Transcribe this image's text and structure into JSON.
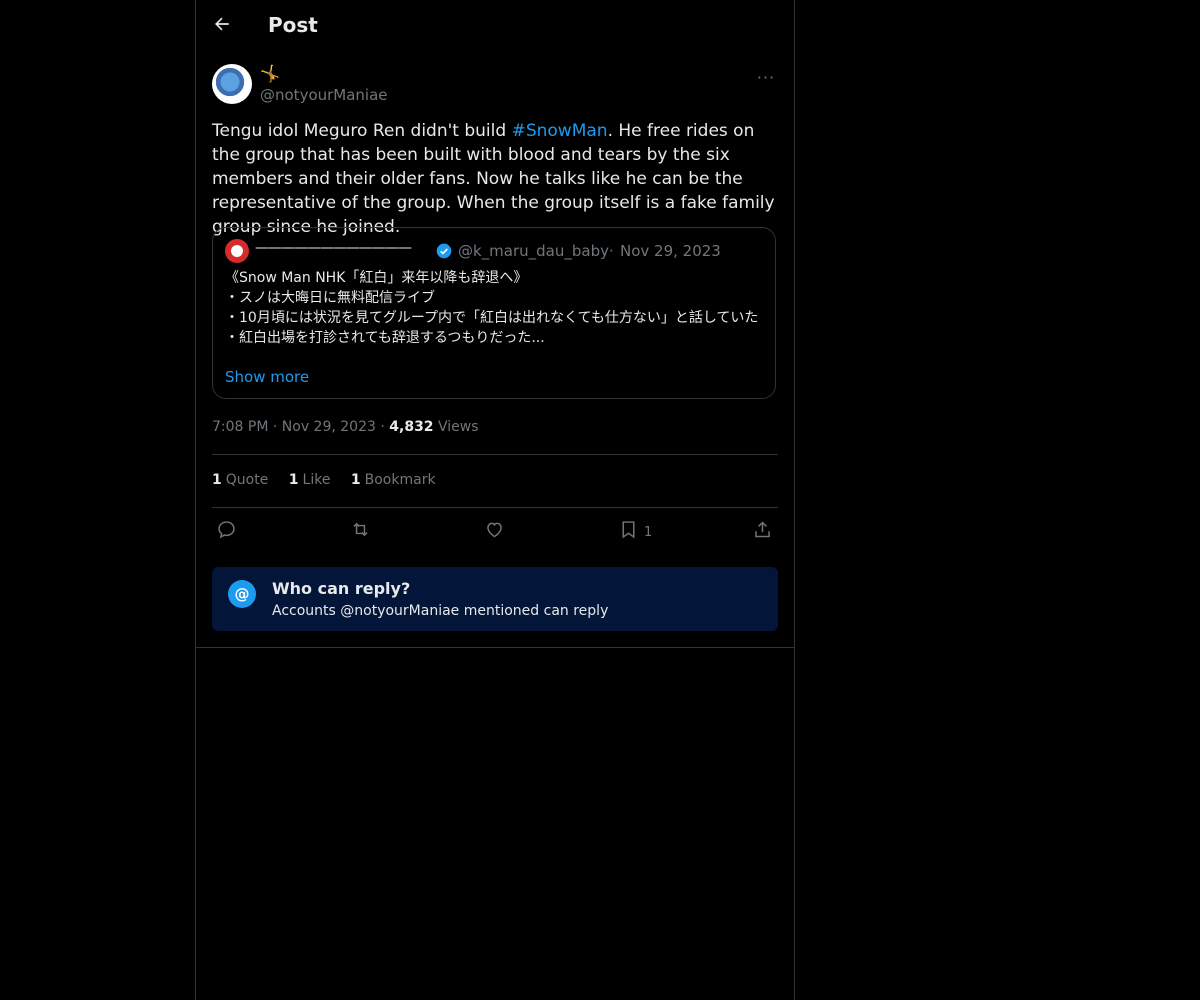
{
  "header": {
    "title": "Post",
    "back_icon": "arrow-left-icon"
  },
  "post": {
    "author_emoji": "🤸",
    "handle": "@notyourManiae",
    "text_before": "Tengu idol Meguro Ren didn't build ",
    "hashtag": "#SnowMan",
    "text_after": ". He free rides on the group that has been built with blood and tears by the six members and their older fans. Now he talks like he can be the representative of the group. When the group itself is a fake family group since he joined.",
    "quote": {
      "name": "————————————",
      "handle": "@k_maru_dau_baby",
      "separator": "·",
      "date": "Nov 29, 2023",
      "lines": [
        "《Snow Man NHK「紅白」来年以降も辞退へ》",
        "・スノは大晦日に無料配信ライブ",
        "・10月頃には状況を見てグループ内で「紅白は出れなくても仕方ない」と話していた",
        "・紅白出場を打診されても辞退するつもりだった..."
      ],
      "show_more": "Show more"
    },
    "meta": {
      "time": "7:08 PM",
      "sep": "·",
      "date": "Nov 29, 2023",
      "views_count": "4,832",
      "views_label": "Views"
    },
    "stats": [
      {
        "count": "1",
        "label": "Quote"
      },
      {
        "count": "1",
        "label": "Like"
      },
      {
        "count": "1",
        "label": "Bookmark"
      }
    ],
    "actions": {
      "bookmark_count": "1"
    },
    "reply_box": {
      "icon": "@",
      "title": "Who can reply?",
      "subtitle": "Accounts @notyourManiae mentioned can reply"
    }
  },
  "colors": {
    "accent": "#1d9bf0",
    "background": "#000000",
    "reply_box_bg": "#031538",
    "muted": "#71767b"
  }
}
